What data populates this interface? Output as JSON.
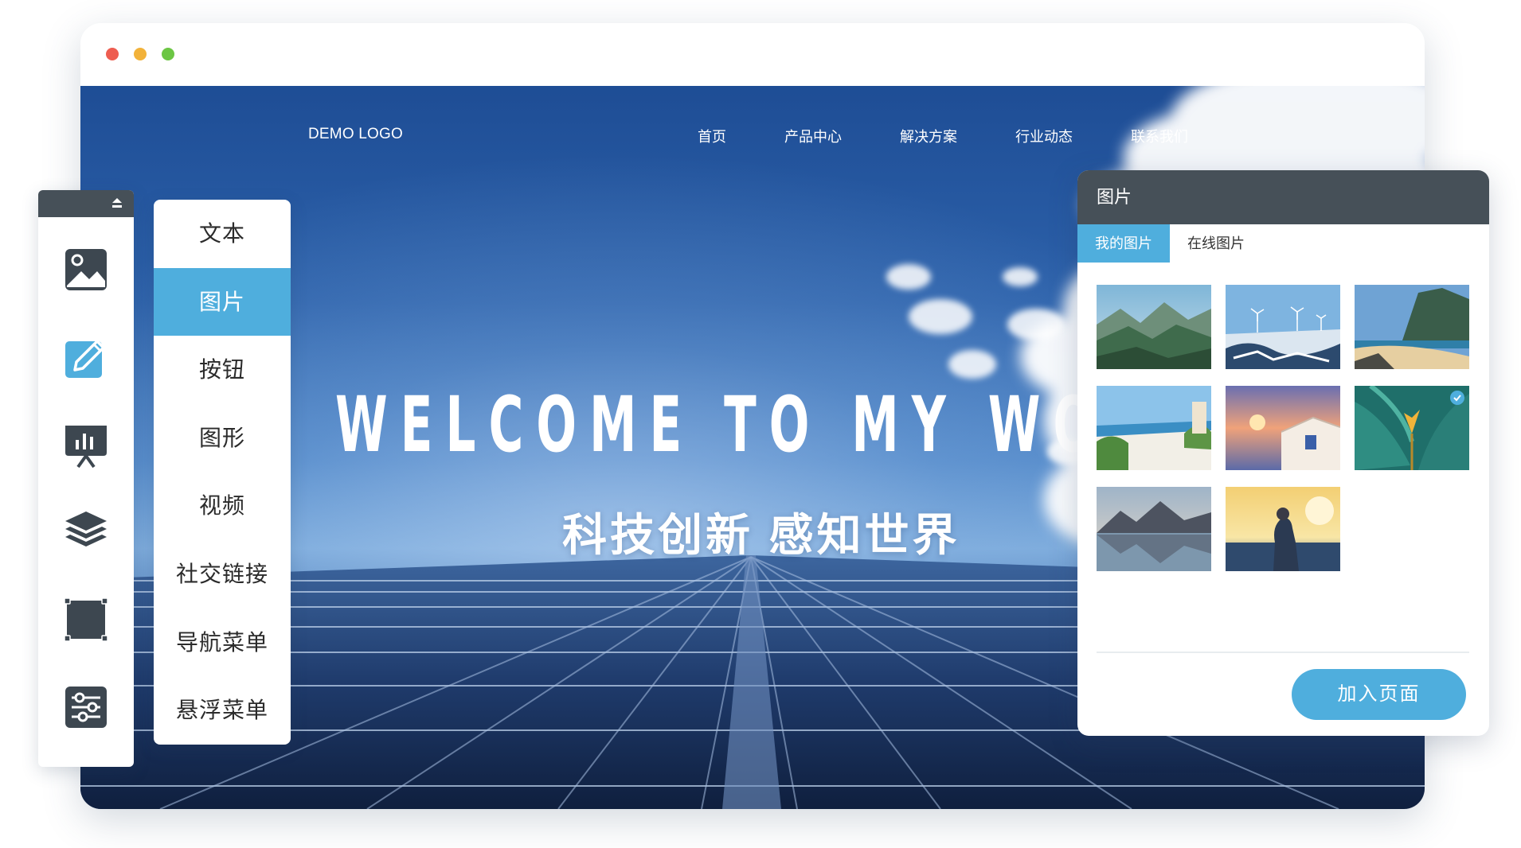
{
  "site": {
    "logo": "DEMO LOGO",
    "nav": [
      "首页",
      "产品中心",
      "解决方案",
      "行业动态",
      "联系我们"
    ],
    "headline": "WELCOME TO MY WORLD",
    "subheadline": "科技创新  感知世界"
  },
  "toolbar": {
    "icons": [
      "image-icon",
      "pencil-icon",
      "presentation-chart-icon",
      "layers-icon",
      "square-frame-icon",
      "sliders-icon"
    ]
  },
  "menu": {
    "items": [
      "文本",
      "图片",
      "按钮",
      "图形",
      "视频",
      "社交链接",
      "导航菜单",
      "悬浮菜单"
    ],
    "active": "图片"
  },
  "panel": {
    "title": "图片",
    "tabs": [
      "我的图片",
      "在线图片"
    ],
    "active_tab": "我的图片",
    "images": [
      "mountains",
      "wind-turbines",
      "coast-cliffs",
      "white-terrace",
      "sunset-house",
      "tropical-leaves",
      "lake-mountains",
      "sunset-photographer"
    ],
    "selected_image": "tropical-leaves",
    "add_button": "加入页面"
  },
  "colors": {
    "accent": "#4faedd",
    "header_dark": "#465058"
  }
}
